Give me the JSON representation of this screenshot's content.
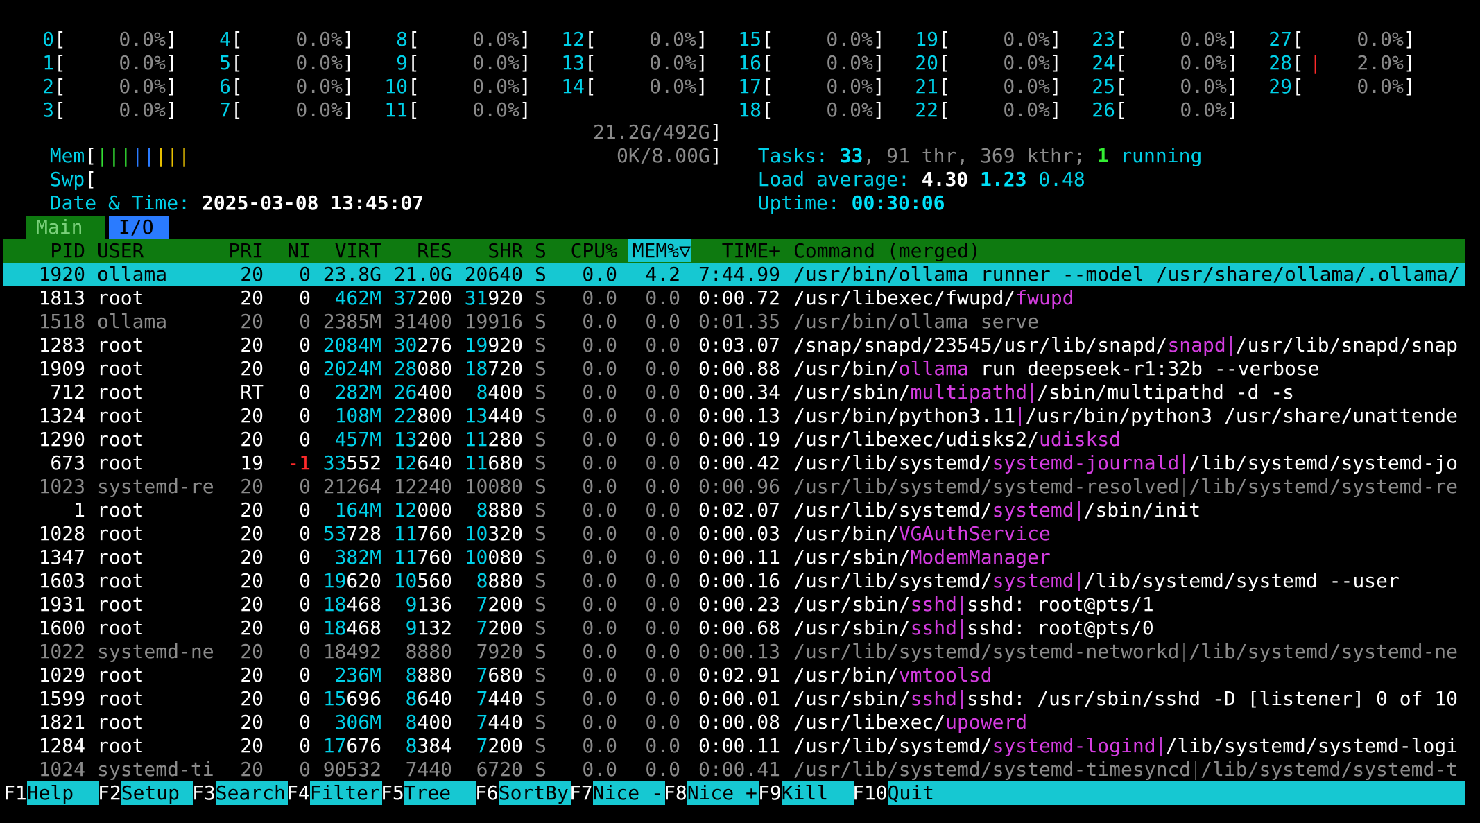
{
  "cpus": [
    {
      "n": "0",
      "v": "0.0%"
    },
    {
      "n": "1",
      "v": "0.0%"
    },
    {
      "n": "2",
      "v": "0.0%"
    },
    {
      "n": "3",
      "v": "0.0%"
    },
    {
      "n": "4",
      "v": "0.0%"
    },
    {
      "n": "5",
      "v": "0.0%"
    },
    {
      "n": "6",
      "v": "0.0%"
    },
    {
      "n": "7",
      "v": "0.0%"
    },
    {
      "n": "8",
      "v": "0.0%"
    },
    {
      "n": "9",
      "v": "0.0%"
    },
    {
      "n": "10",
      "v": "0.0%"
    },
    {
      "n": "11",
      "v": "0.0%"
    },
    {
      "n": "12",
      "v": "0.0%"
    },
    {
      "n": "13",
      "v": "0.0%"
    },
    {
      "n": "14",
      "v": "0.0%"
    },
    {
      "n": "15",
      "v": "0.0%"
    },
    {
      "n": "16",
      "v": "0.0%"
    },
    {
      "n": "17",
      "v": "0.0%"
    },
    {
      "n": "18",
      "v": "0.0%"
    },
    {
      "n": "19",
      "v": "0.0%"
    },
    {
      "n": "20",
      "v": "0.0%"
    },
    {
      "n": "21",
      "v": "0.0%"
    },
    {
      "n": "22",
      "v": "0.0%"
    },
    {
      "n": "23",
      "v": "0.0%"
    },
    {
      "n": "24",
      "v": "0.0%"
    },
    {
      "n": "25",
      "v": "0.0%"
    },
    {
      "n": "26",
      "v": "0.0%"
    },
    {
      "n": "27",
      "v": "0.0%"
    },
    {
      "n": "28",
      "v": "2.0%"
    },
    {
      "n": "29",
      "v": "0.0%"
    }
  ],
  "meters": {
    "mem_label": "Mem",
    "mem_value": "21.2G/492G",
    "swp_label": "Swp",
    "swp_value": "0K/8.00G",
    "date_label": "Date & Time:",
    "date_value": "2025-03-08 13:45:07"
  },
  "tasks": {
    "label": "Tasks:",
    "count": "33",
    "threads": ", 91 thr, 369 kthr; ",
    "running": "1",
    "running_label": " running"
  },
  "load": {
    "label": "Load average:",
    "l1": "4.30",
    "l5": "1.23",
    "l15": "0.48"
  },
  "uptime": {
    "label": "Uptime:",
    "value": "00:30:06"
  },
  "tabs": {
    "main": "Main",
    "io": "I/O"
  },
  "columns": {
    "pid": "PID",
    "user": "USER",
    "pri": "PRI",
    "ni": "NI",
    "virt": "VIRT",
    "res": "RES",
    "shr": "SHR",
    "s": "S",
    "cpu": "CPU%",
    "mem": "MEM%▽",
    "time": "TIME+",
    "cmd": "Command (merged)"
  },
  "processes": [
    {
      "pid": "1920",
      "user": "ollama",
      "pri": "20",
      "ni": "0",
      "virt": "23.8G",
      "res": "21.0G",
      "shr": "20640",
      "s": "S",
      "cpu": "0.0",
      "mem": "4.2",
      "time": "7:44.99",
      "cmd": "/usr/bin/ollama runner --model /usr/share/ollama/.ollama/",
      "selected": true
    },
    {
      "pid": "1813",
      "user": "root",
      "pri": "20",
      "ni": "0",
      "virt": "462M",
      "res": "37200",
      "shr": "31920",
      "s": "S",
      "cpu": "0.0",
      "mem": "0.0",
      "time": "0:00.72",
      "cmd_a": "/usr/libexec/fwupd/",
      "cmd_b": "fwupd",
      "cmd_c": ""
    },
    {
      "pid": "1518",
      "user": "ollama",
      "pri": "20",
      "ni": "0",
      "virt": "2385M",
      "res": "31400",
      "shr": "19916",
      "s": "S",
      "cpu": "0.0",
      "mem": "0.0",
      "time": "0:01.35",
      "cmd": "/usr/bin/ollama serve",
      "dim": true
    },
    {
      "pid": "1283",
      "user": "root",
      "pri": "20",
      "ni": "0",
      "virt": "2084M",
      "res": "30276",
      "shr": "19920",
      "s": "S",
      "cpu": "0.0",
      "mem": "0.0",
      "time": "0:03.07",
      "cmd_a": "/snap/snapd/23545/usr/lib/snapd/",
      "cmd_b": "snapd",
      "cmd_c": "/usr/lib/snapd/snap"
    },
    {
      "pid": "1909",
      "user": "root",
      "pri": "20",
      "ni": "0",
      "virt": "2024M",
      "res": "28080",
      "shr": "18720",
      "s": "S",
      "cpu": "0.0",
      "mem": "0.0",
      "time": "0:00.88",
      "cmd_a": "/usr/bin/",
      "cmd_b": "ollama",
      "cmd_c": " run deepseek-r1:32b --verbose",
      "nosep": true
    },
    {
      "pid": "712",
      "user": "root",
      "pri": "RT",
      "ni": "0",
      "virt": "282M",
      "res": "26400",
      "shr": "8400",
      "s": "S",
      "cpu": "0.0",
      "mem": "0.0",
      "time": "0:00.34",
      "cmd_a": "/usr/sbin/",
      "cmd_b": "multipathd",
      "cmd_c": "/sbin/multipathd -d -s"
    },
    {
      "pid": "1324",
      "user": "root",
      "pri": "20",
      "ni": "0",
      "virt": "108M",
      "res": "22800",
      "shr": "13440",
      "s": "S",
      "cpu": "0.0",
      "mem": "0.0",
      "time": "0:00.13",
      "cmd_a": "/usr/bin/python3.11",
      "cmd_b": "",
      "cmd_c": "/usr/bin/python3 /usr/share/unattende"
    },
    {
      "pid": "1290",
      "user": "root",
      "pri": "20",
      "ni": "0",
      "virt": "457M",
      "res": "13200",
      "shr": "11280",
      "s": "S",
      "cpu": "0.0",
      "mem": "0.0",
      "time": "0:00.19",
      "cmd_a": "/usr/libexec/udisks2/",
      "cmd_b": "udisksd",
      "cmd_c": ""
    },
    {
      "pid": "673",
      "user": "root",
      "pri": "19",
      "ni": "-1",
      "virt": "33552",
      "res": "12640",
      "shr": "11680",
      "s": "S",
      "cpu": "0.0",
      "mem": "0.0",
      "time": "0:00.42",
      "cmd_a": "/usr/lib/systemd/",
      "cmd_b": "systemd-journald",
      "cmd_c": "/lib/systemd/systemd-jo"
    },
    {
      "pid": "1023",
      "user": "systemd-re",
      "pri": "20",
      "ni": "0",
      "virt": "21264",
      "res": "12240",
      "shr": "10080",
      "s": "S",
      "cpu": "0.0",
      "mem": "0.0",
      "time": "0:00.96",
      "cmd": "/usr/lib/systemd/systemd-resolved",
      "cmd_c": "/lib/systemd/systemd-re",
      "dim": true
    },
    {
      "pid": "1",
      "user": "root",
      "pri": "20",
      "ni": "0",
      "virt": "164M",
      "res": "12000",
      "shr": "8880",
      "s": "S",
      "cpu": "0.0",
      "mem": "0.0",
      "time": "0:02.07",
      "cmd_a": "/usr/lib/systemd/",
      "cmd_b": "systemd",
      "cmd_c": "/sbin/init"
    },
    {
      "pid": "1028",
      "user": "root",
      "pri": "20",
      "ni": "0",
      "virt": "53728",
      "res": "11760",
      "shr": "10320",
      "s": "S",
      "cpu": "0.0",
      "mem": "0.0",
      "time": "0:00.03",
      "cmd_a": "/usr/bin/",
      "cmd_b": "VGAuthService",
      "cmd_c": ""
    },
    {
      "pid": "1347",
      "user": "root",
      "pri": "20",
      "ni": "0",
      "virt": "382M",
      "res": "11760",
      "shr": "10080",
      "s": "S",
      "cpu": "0.0",
      "mem": "0.0",
      "time": "0:00.11",
      "cmd_a": "/usr/sbin/",
      "cmd_b": "ModemManager",
      "cmd_c": ""
    },
    {
      "pid": "1603",
      "user": "root",
      "pri": "20",
      "ni": "0",
      "virt": "19620",
      "res": "10560",
      "shr": "8880",
      "s": "S",
      "cpu": "0.0",
      "mem": "0.0",
      "time": "0:00.16",
      "cmd_a": "/usr/lib/systemd/",
      "cmd_b": "systemd",
      "cmd_c": "/lib/systemd/systemd --user"
    },
    {
      "pid": "1931",
      "user": "root",
      "pri": "20",
      "ni": "0",
      "virt": "18468",
      "res": "9136",
      "shr": "7200",
      "s": "S",
      "cpu": "0.0",
      "mem": "0.0",
      "time": "0:00.23",
      "cmd_a": "/usr/sbin/",
      "cmd_b": "sshd",
      "cmd_c": "sshd: root@pts/1"
    },
    {
      "pid": "1600",
      "user": "root",
      "pri": "20",
      "ni": "0",
      "virt": "18468",
      "res": "9132",
      "shr": "7200",
      "s": "S",
      "cpu": "0.0",
      "mem": "0.0",
      "time": "0:00.68",
      "cmd_a": "/usr/sbin/",
      "cmd_b": "sshd",
      "cmd_c": "sshd: root@pts/0"
    },
    {
      "pid": "1022",
      "user": "systemd-ne",
      "pri": "20",
      "ni": "0",
      "virt": "18492",
      "res": "8880",
      "shr": "7920",
      "s": "S",
      "cpu": "0.0",
      "mem": "0.0",
      "time": "0:00.13",
      "cmd": "/usr/lib/systemd/systemd-networkd",
      "cmd_c": "/lib/systemd/systemd-ne",
      "dim": true
    },
    {
      "pid": "1029",
      "user": "root",
      "pri": "20",
      "ni": "0",
      "virt": "236M",
      "res": "8880",
      "shr": "7680",
      "s": "S",
      "cpu": "0.0",
      "mem": "0.0",
      "time": "0:02.91",
      "cmd_a": "/usr/bin/",
      "cmd_b": "vmtoolsd",
      "cmd_c": ""
    },
    {
      "pid": "1599",
      "user": "root",
      "pri": "20",
      "ni": "0",
      "virt": "15696",
      "res": "8640",
      "shr": "7440",
      "s": "S",
      "cpu": "0.0",
      "mem": "0.0",
      "time": "0:00.01",
      "cmd_a": "/usr/sbin/",
      "cmd_b": "sshd",
      "cmd_c": "sshd: /usr/sbin/sshd -D [listener] 0 of 10"
    },
    {
      "pid": "1821",
      "user": "root",
      "pri": "20",
      "ni": "0",
      "virt": "306M",
      "res": "8400",
      "shr": "7440",
      "s": "S",
      "cpu": "0.0",
      "mem": "0.0",
      "time": "0:00.08",
      "cmd_a": "/usr/libexec/",
      "cmd_b": "upowerd",
      "cmd_c": ""
    },
    {
      "pid": "1284",
      "user": "root",
      "pri": "20",
      "ni": "0",
      "virt": "17676",
      "res": "8384",
      "shr": "7200",
      "s": "S",
      "cpu": "0.0",
      "mem": "0.0",
      "time": "0:00.11",
      "cmd_a": "/usr/lib/systemd/",
      "cmd_b": "systemd-logind",
      "cmd_c": "/lib/systemd/systemd-logi"
    },
    {
      "pid": "1024",
      "user": "systemd-ti",
      "pri": "20",
      "ni": "0",
      "virt": "90532",
      "res": "7440",
      "shr": "6720",
      "s": "S",
      "cpu": "0.0",
      "mem": "0.0",
      "time": "0:00.41",
      "cmd": "/usr/lib/systemd/systemd-timesyncd",
      "cmd_c": "/lib/systemd/systemd-t",
      "dim": true
    }
  ],
  "fnkeys": [
    {
      "key": "F1",
      "label": "Help"
    },
    {
      "key": "F2",
      "label": "Setup"
    },
    {
      "key": "F3",
      "label": "Search"
    },
    {
      "key": "F4",
      "label": "Filter"
    },
    {
      "key": "F5",
      "label": "Tree"
    },
    {
      "key": "F6",
      "label": "SortBy"
    },
    {
      "key": "F7",
      "label": "Nice -"
    },
    {
      "key": "F8",
      "label": "Nice +"
    },
    {
      "key": "F9",
      "label": "Kill"
    },
    {
      "key": "F10",
      "label": "Quit"
    }
  ],
  "colors": {
    "cyan": "#00d0e8",
    "selection": "#16c8d2",
    "header": "#0e7a10",
    "magenta": "#d43de0"
  }
}
